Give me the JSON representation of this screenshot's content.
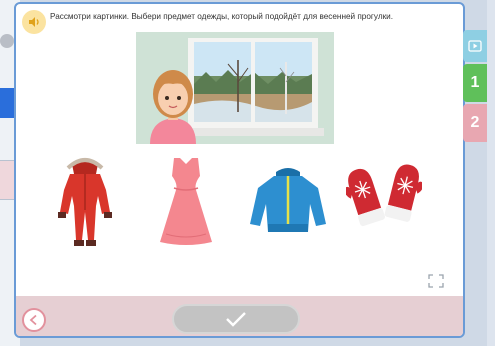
{
  "task": {
    "instruction": "Рассмотри картинки. Выбери предмет одежды, который подойдёт для весенней прогулки."
  },
  "icons": {
    "speaker": "speaker-icon",
    "expand": "fullscreen-icon",
    "back": "chevron-left-icon",
    "check": "checkmark-icon",
    "video": "video-icon"
  },
  "answers": [
    {
      "name": "red-snowsuit"
    },
    {
      "name": "pink-dress"
    },
    {
      "name": "blue-jacket"
    },
    {
      "name": "red-mittens"
    }
  ],
  "side_tabs": {
    "tab1_label": "1",
    "tab2_label": "2"
  },
  "colors": {
    "card_border": "#6a9bd6",
    "footer": "#e6cfd3",
    "tab_active": "#5fc05a",
    "tab_inactive": "#e8a7b1",
    "tab_video": "#8ecfe3",
    "check_button": "#c3c3c3"
  }
}
